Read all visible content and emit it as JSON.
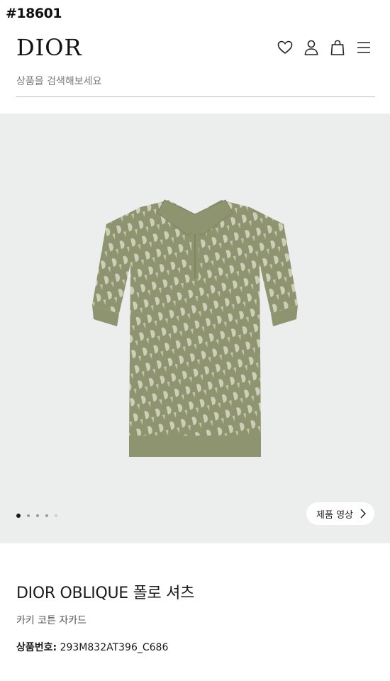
{
  "watermark_tag": "#18601",
  "header": {
    "logo": "DIOR",
    "icons": [
      "heart-icon",
      "user-icon",
      "shopping-bag-icon",
      "menu-icon"
    ]
  },
  "search": {
    "placeholder": "상품을 검색해보세요"
  },
  "gallery": {
    "slide_count": 5,
    "active_slide": 1,
    "video_button_label": "제품 영상"
  },
  "product": {
    "name": "DIOR OBLIQUE 폴로 셔츠",
    "subtitle": "카키 코튼 자카드",
    "sku_label": "상품번호:",
    "sku_value": "293M832AT396_C686"
  },
  "colors": {
    "background": "#ffffff",
    "gallery_bg": "#eceded",
    "shirt_khaki": "#8f9470",
    "pattern_light": "#d9d8c2"
  }
}
